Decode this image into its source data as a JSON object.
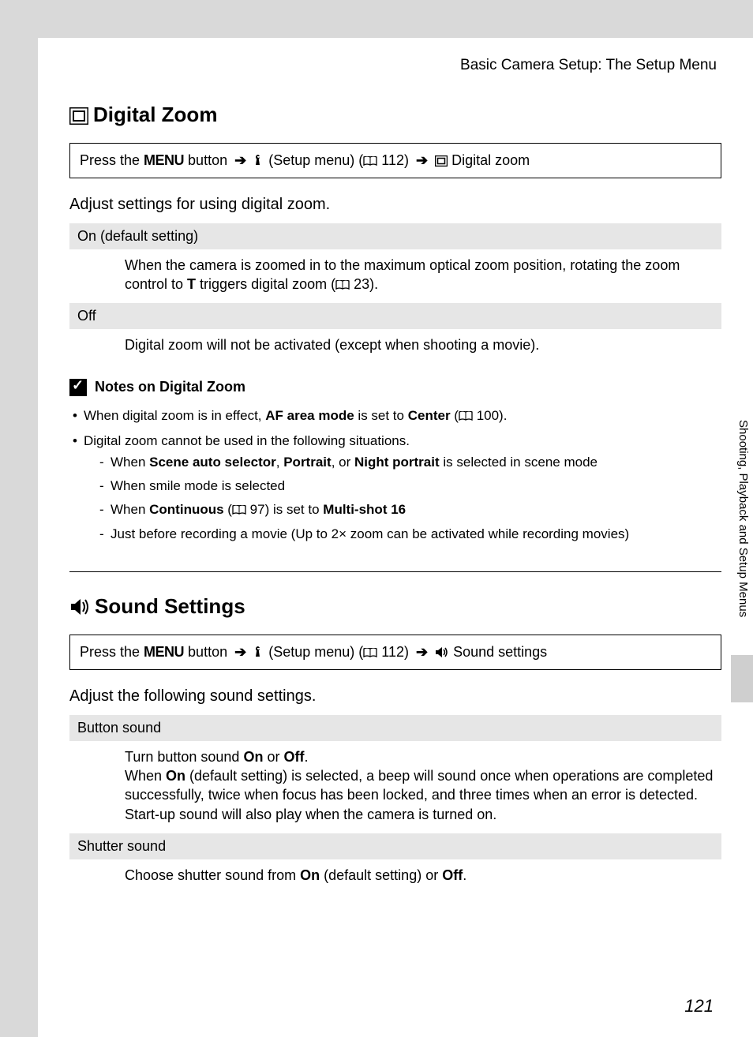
{
  "header": "Basic Camera Setup: The Setup Menu",
  "sideTab": "Shooting, Playback and Setup Menus",
  "pageNumber": "121",
  "sec1": {
    "title": "Digital Zoom",
    "nav": {
      "press": "Press the ",
      "menu": "MENU",
      "button": " button ",
      "setup": " (Setup menu) (",
      "ref": " 112) ",
      "item": " Digital zoom"
    },
    "intro": "Adjust settings for using digital zoom.",
    "opt1": {
      "head": "On (default setting)",
      "body_a": "When the camera is zoomed in to the maximum optical zoom position, rotating the zoom control to ",
      "body_t": "T",
      "body_b": " triggers digital zoom (",
      "ref": " 23)."
    },
    "opt2": {
      "head": "Off",
      "body": "Digital zoom will not be activated (except when shooting a movie)."
    },
    "notes": {
      "title": "Notes on Digital Zoom",
      "n1a": "When digital zoom is in effect, ",
      "n1b": "AF area mode",
      "n1c": " is set to ",
      "n1d": "Center",
      "n1e": " (",
      "n1ref": " 100).",
      "n2": "Digital zoom cannot be used in the following situations.",
      "s1a": "When ",
      "s1b": "Scene auto selector",
      "s1c": ", ",
      "s1d": "Portrait",
      "s1e": ", or ",
      "s1f": "Night portrait",
      "s1g": " is selected in scene mode",
      "s2": "When smile mode is selected",
      "s3a": "When ",
      "s3b": "Continuous",
      "s3c": " (",
      "s3ref": " 97) is set to ",
      "s3d": "Multi-shot 16",
      "s4": "Just before recording a movie (Up to 2× zoom can be activated while recording movies)"
    }
  },
  "sec2": {
    "title": "Sound Settings",
    "nav": {
      "press": "Press the ",
      "menu": "MENU",
      "button": " button ",
      "setup": " (Setup menu) (",
      "ref": " 112) ",
      "item": " Sound settings"
    },
    "intro": "Adjust the following sound settings.",
    "opt1": {
      "head": "Button sound",
      "b1": "Turn button sound ",
      "b2": "On",
      "b3": " or ",
      "b4": "Off",
      "b5": ".",
      "c1": "When ",
      "c2": "On",
      "c3": " (default setting) is selected, a beep will sound once when operations are completed successfully, twice when focus has been locked, and three times when an error is detected. Start-up sound will also play when the camera is turned on."
    },
    "opt2": {
      "head": "Shutter sound",
      "b1": "Choose shutter sound from ",
      "b2": "On",
      "b3": " (default setting) or ",
      "b4": "Off",
      "b5": "."
    }
  }
}
